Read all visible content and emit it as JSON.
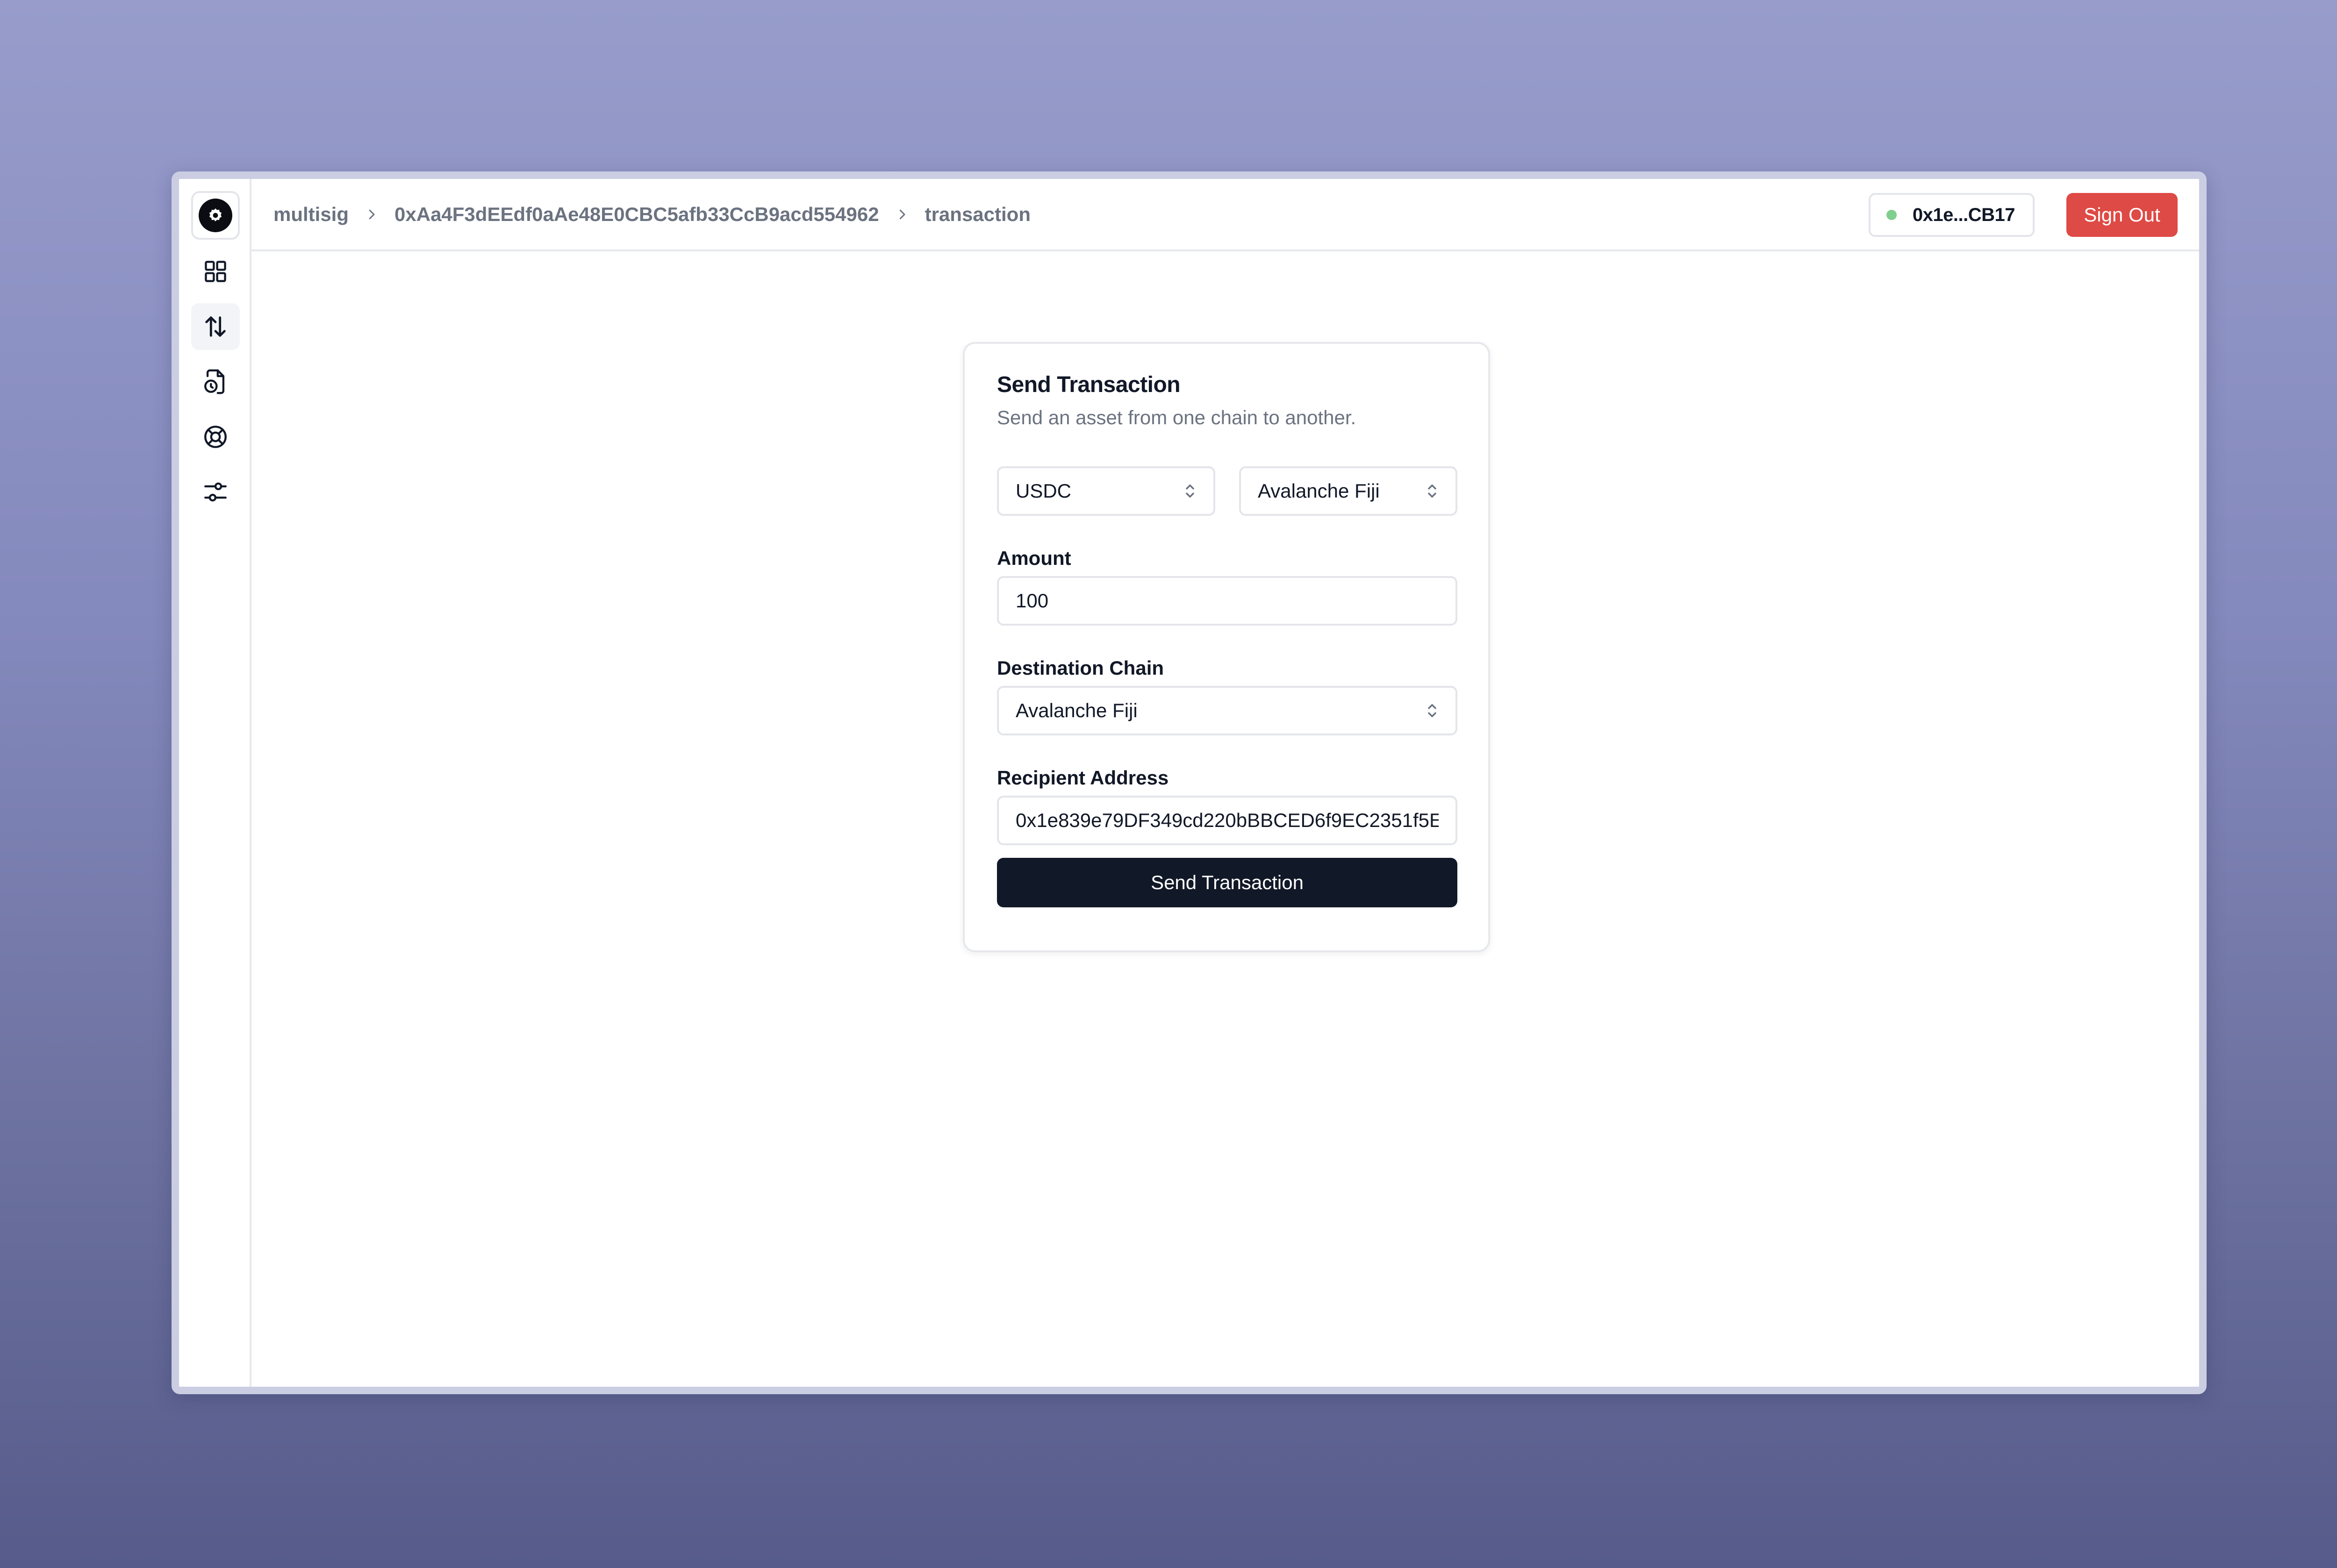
{
  "breadcrumb": {
    "items": [
      "multisig",
      "0xAa4F3dEEdf0aAe48E0CBC5afb33CcB9acd554962",
      "transaction"
    ]
  },
  "header": {
    "wallet_address": "0x1e...CB17",
    "sign_out_label": "Sign Out",
    "status_color": "#7fcf8e",
    "sign_out_color": "#de4a45"
  },
  "sidebar": {
    "items": [
      {
        "icon": "grid-icon",
        "name": "dashboard"
      },
      {
        "icon": "arrows-up-down-icon",
        "name": "transactions",
        "active": true
      },
      {
        "icon": "file-clock-icon",
        "name": "history"
      },
      {
        "icon": "life-buoy-icon",
        "name": "support"
      },
      {
        "icon": "sliders-icon",
        "name": "settings"
      }
    ]
  },
  "card": {
    "title": "Send Transaction",
    "description": "Send an asset from one chain to another.",
    "asset_select": "USDC",
    "source_chain_select": "Avalanche Fiji",
    "amount_label": "Amount",
    "amount_value": "100",
    "destination_label": "Destination Chain",
    "destination_value": "Avalanche Fiji",
    "recipient_label": "Recipient Address",
    "recipient_value": "0x1e839e79DF349cd220bBBCED6f9EC2351f5E",
    "send_label": "Send Transaction"
  }
}
